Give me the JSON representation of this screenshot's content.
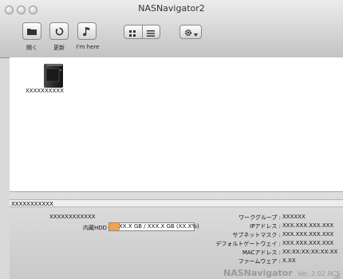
{
  "window": {
    "title": "NASNavigator2"
  },
  "toolbar": {
    "open_label": "開く",
    "refresh_label": "更新",
    "imhere_label": "I'm here"
  },
  "devices": [
    {
      "name": "XXXXXXXXXX"
    }
  ],
  "details": {
    "header_name": "XXXXXXXXXXX",
    "device_name": "XXXXXXXXXXXX",
    "hdd_label": "内蔵HDD",
    "hdd_value": "XX.X GB / XXX.X GB (XX.X%)",
    "hdd_usage_fraction": 0.12,
    "info": [
      {
        "label": "ワークグループ :",
        "value": "XXXXXX"
      },
      {
        "label": "IPアドレス :",
        "value": "XXX.XXX.XXX.XXX"
      },
      {
        "label": "サブネットマスク :",
        "value": "XXX.XXX.XXX.XXX"
      },
      {
        "label": "デフォルトゲートウェイ :",
        "value": "XXX.XXX.XXX.XXX"
      },
      {
        "label": "MACアドレス :",
        "value": "XX:XX:XX:XX:XX:XX"
      },
      {
        "label": "ファームウェア :",
        "value": "X.XX"
      }
    ]
  },
  "footer": {
    "brand": "NASNavigator",
    "version": "Ver. 2.02 RC5"
  },
  "colors": {
    "hdd_fill": "#f3a14b",
    "window_bg": "#d9d9d9"
  }
}
